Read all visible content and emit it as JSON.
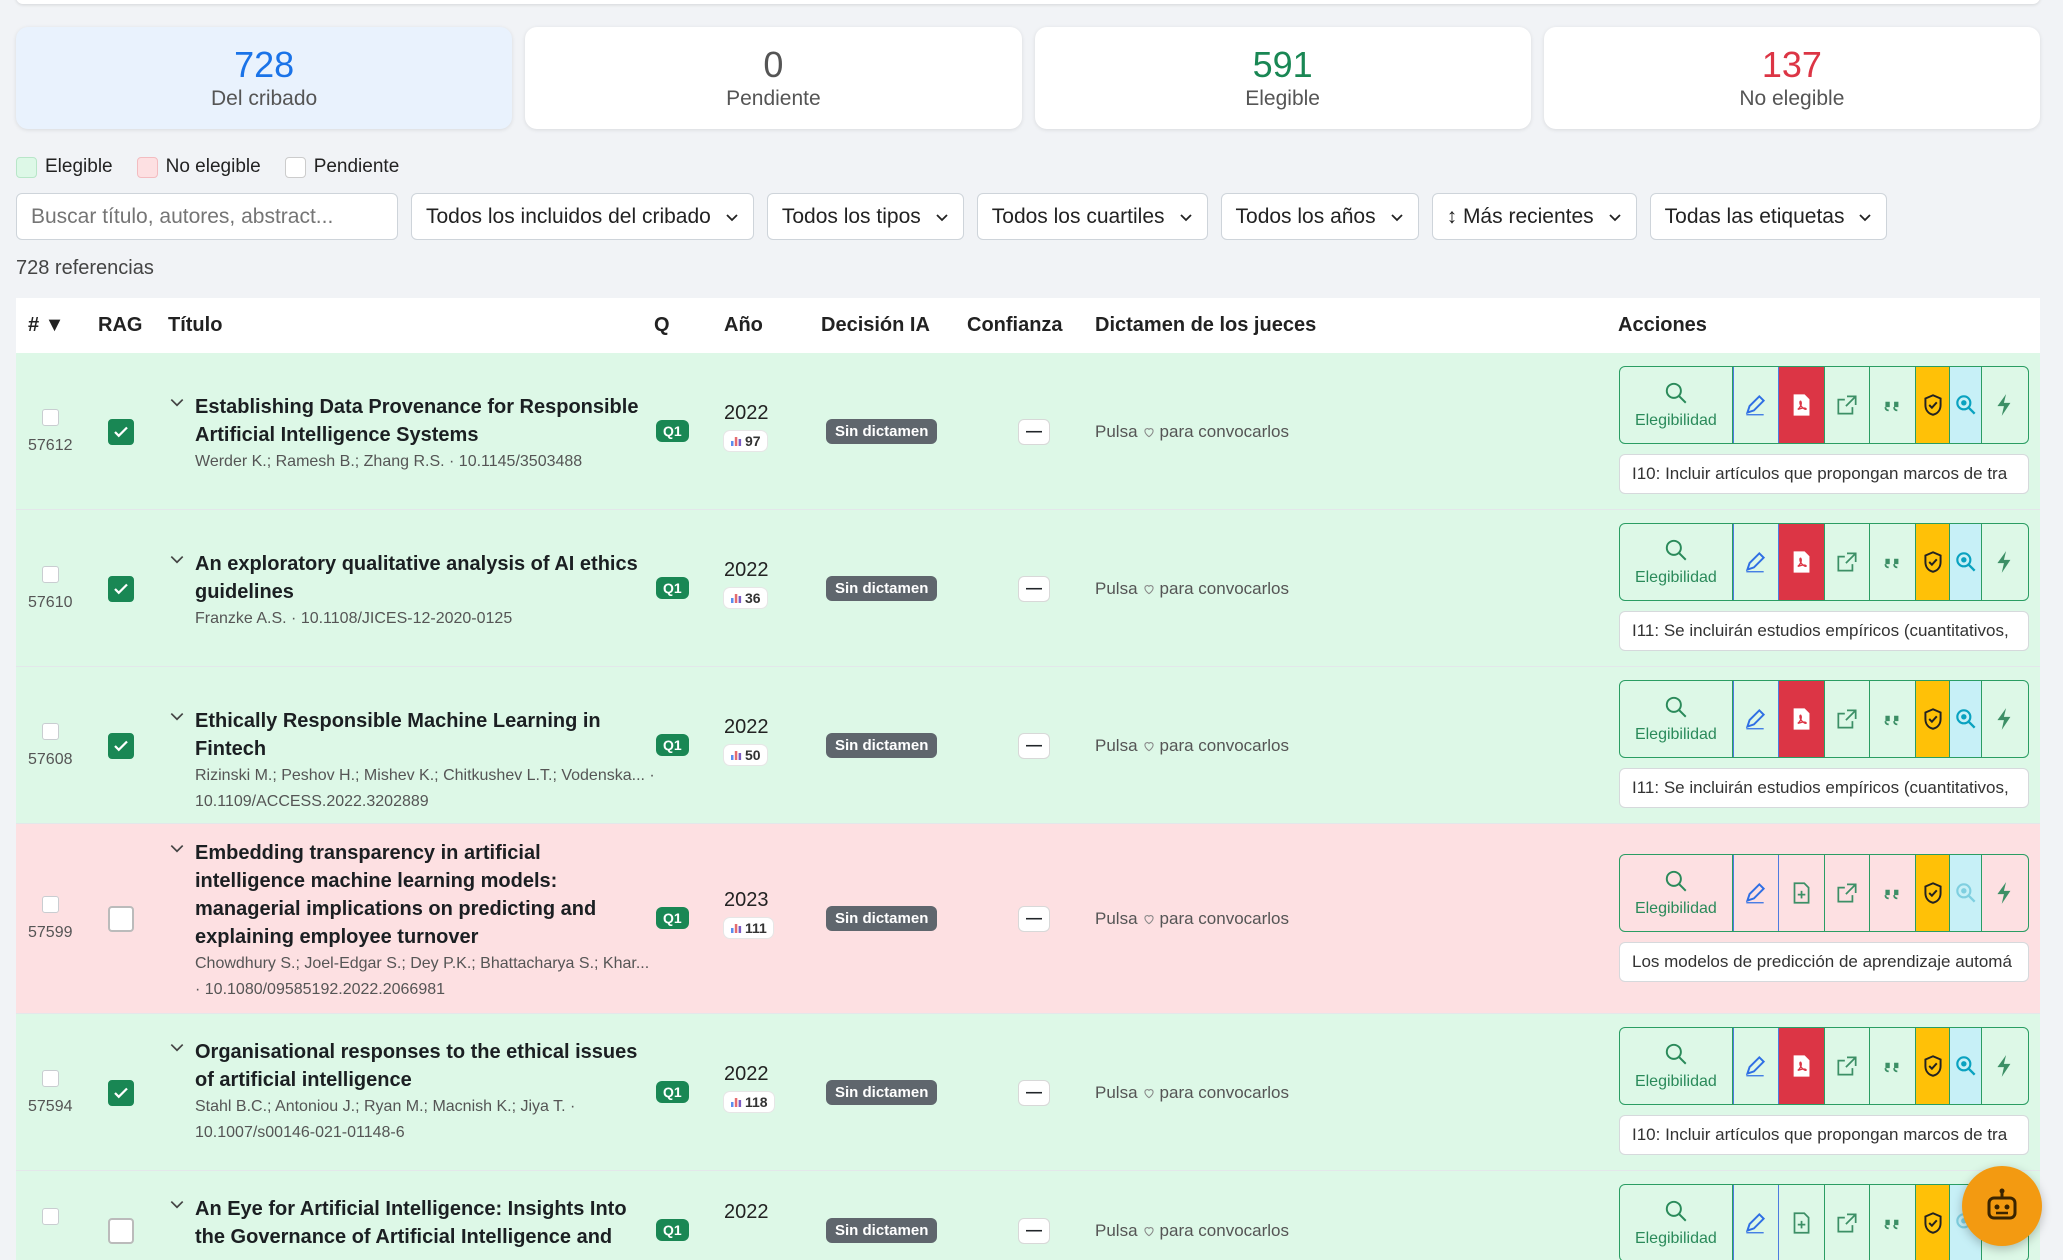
{
  "stats": [
    {
      "value": "728",
      "label": "Del cribado",
      "color": "#1a73e8"
    },
    {
      "value": "0",
      "label": "Pendiente",
      "color": "#555555"
    },
    {
      "value": "591",
      "label": "Elegible",
      "color": "#198754"
    },
    {
      "value": "137",
      "label": "No elegible",
      "color": "#dc3545"
    }
  ],
  "legend": {
    "eligible": "Elegible",
    "not_eligible": "No elegible",
    "pending": "Pendiente"
  },
  "filters": {
    "search_placeholder": "Buscar título, autores, abstract...",
    "included": "Todos los incluidos del cribado",
    "types": "Todos los tipos",
    "quartiles": "Todos los cuartiles",
    "years": "Todos los años",
    "sort": "↕ Más recientes",
    "tags": "Todas las etiquetas"
  },
  "count_label": "728 referencias",
  "columns": {
    "num": "# ▼",
    "rag": "RAG",
    "title": "Título",
    "q": "Q",
    "year": "Año",
    "ai": "Decisión IA",
    "conf": "Confianza",
    "judges": "Dictamen de los jueces",
    "actions": "Acciones"
  },
  "row_common": {
    "ai_badge": "Sin dictamen",
    "confidence": "—",
    "pulsa": "Pulsa",
    "pulsa_tail": "para convocarlos",
    "eleg_btn": "Elegibilidad"
  },
  "rows": [
    {
      "id": "57612",
      "status": "eligible",
      "rag": true,
      "title": "Establishing Data Provenance for Responsible Artificial Intelligence Systems",
      "authors": "Werder K.; Ramesh B.; Zhang R.S. · 10.1145/3503488",
      "q": "Q1",
      "year": "2022",
      "cites": "97",
      "pdf": true,
      "criterion": "I10: Incluir artículos que propongan marcos de tra"
    },
    {
      "id": "57610",
      "status": "eligible",
      "rag": true,
      "title": "An exploratory qualitative analysis of AI ethics guidelines",
      "authors": "Franzke A.S. · 10.1108/JICES-12-2020-0125",
      "q": "Q1",
      "year": "2022",
      "cites": "36",
      "pdf": true,
      "criterion": "I11: Se incluirán estudios empíricos (cuantitativos,"
    },
    {
      "id": "57608",
      "status": "eligible",
      "rag": true,
      "title": "Ethically Responsible Machine Learning in Fintech",
      "authors": "Rizinski M.; Peshov H.; Mishev K.; Chitkushev L.T.; Vodenska... · 10.1109/ACCESS.2022.3202889",
      "q": "Q1",
      "year": "2022",
      "cites": "50",
      "pdf": true,
      "criterion": "I11: Se incluirán estudios empíricos (cuantitativos,"
    },
    {
      "id": "57599",
      "status": "not_eligible",
      "rag": false,
      "title": "Embedding transparency in artificial intelligence machine learning models: managerial implications on predicting and explaining employee turnover",
      "authors": "Chowdhury S.; Joel-Edgar S.; Dey P.K.; Bhattacharya S.; Khar... · 10.1080/09585192.2022.2066981",
      "q": "Q1",
      "year": "2023",
      "cites": "111",
      "pdf": false,
      "criterion": "Los modelos de predicción de aprendizaje automá"
    },
    {
      "id": "57594",
      "status": "eligible",
      "rag": true,
      "title": "Organisational responses to the ethical issues of artificial intelligence",
      "authors": "Stahl B.C.; Antoniou J.; Ryan M.; Macnish K.; Jiya T. · 10.1007/s00146-021-01148-6",
      "q": "Q1",
      "year": "2022",
      "cites": "118",
      "pdf": true,
      "criterion": "I10: Incluir artículos que propongan marcos de tra"
    },
    {
      "id": "",
      "status": "eligible",
      "rag": false,
      "title": "An Eye for Artificial Intelligence: Insights Into the Governance of Artificial Intelligence and",
      "authors": "",
      "q": "Q1",
      "year": "2022",
      "cites": "",
      "pdf": false,
      "criterion": ""
    }
  ],
  "colors": {
    "eligible_bg": "#ddf8e7",
    "not_eligible_bg": "#fde0e2",
    "accent_green": "#198754",
    "pdf_red": "#dc3545",
    "shield_yellow": "#ffc107",
    "fab_orange": "#f39a11"
  },
  "icons": {
    "search": "search-icon",
    "edit": "pencil-icon",
    "pdf": "pdf-icon",
    "external": "external-link-icon",
    "quote": "quote-icon",
    "shield": "shield-check-icon",
    "rag": "rag-search-icon",
    "bolt": "bolt-icon",
    "robot": "robot-icon"
  }
}
